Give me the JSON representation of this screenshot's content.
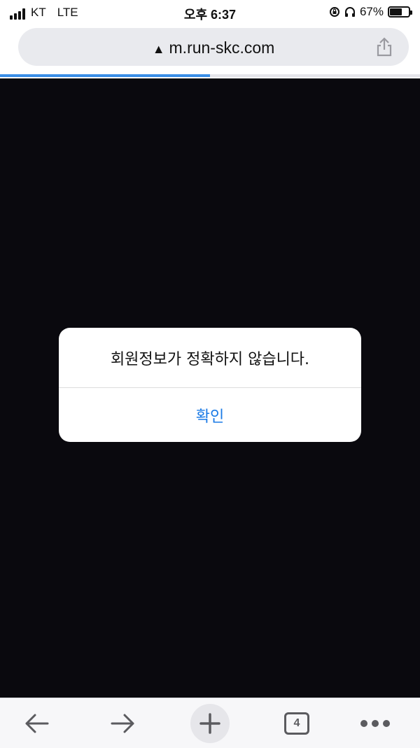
{
  "status_bar": {
    "carrier": "KT",
    "network": "LTE",
    "time": "오후 6:37",
    "battery_percent": "67%",
    "battery_level": 0.67
  },
  "browser": {
    "url": "m.run-skc.com",
    "security_icon": "warning-icon",
    "load_progress": 0.5,
    "tab_count": "4"
  },
  "alert": {
    "message": "회원정보가 정확하지 않습니다.",
    "confirm_label": "확인"
  },
  "toolbar": {
    "icons": [
      "back-arrow-icon",
      "forward-arrow-icon",
      "plus-icon",
      "tabs-icon",
      "more-icon"
    ]
  },
  "colors": {
    "accent": "#1a7ae6",
    "page_background": "#0a090e",
    "progress": "#3a8ee6"
  }
}
